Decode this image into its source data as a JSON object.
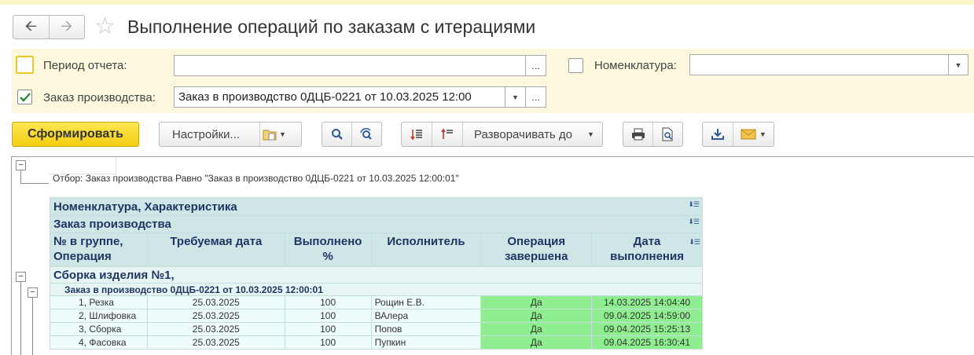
{
  "window": {
    "title": "Выполнение операций по заказам с итерациями"
  },
  "filters": {
    "period_label": "Период отчета:",
    "period_value": "",
    "period_checked": false,
    "nomenclature_label": "Номенклатура:",
    "nomenclature_value": "",
    "nomenclature_checked": false,
    "order_label": "Заказ производства:",
    "order_value": "Заказ в производство 0ДЦБ-0221 от 10.03.2025 12:00",
    "order_checked": true,
    "select_button": "..."
  },
  "toolbar": {
    "generate_label": "Сформировать",
    "settings_label": "Настройки...",
    "expand_label": "Разворачивать до"
  },
  "report": {
    "filter_text": "Отбор:   Заказ производства Равно \"Заказ в производство 0ДЦБ-0221 от 10.03.2025 12:00:01\"",
    "header_row1": "Номенклатура, Характеристика",
    "header_row2": "Заказ производства",
    "columns": [
      "№ в группе,\nОперация",
      "Требуемая дата",
      "Выполнено\n%",
      "Исполнитель",
      "Операция\nзавершена",
      "Дата\nвыполнения"
    ],
    "group_name": "Сборка изделия №1,",
    "subgroup_name": "Заказ в производство 0ДЦБ-0221 от 10.03.2025 12:00:01",
    "rows": [
      {
        "op": "1, Резка",
        "date": "25.03.2025",
        "pct": "100",
        "executor": "Рощин Е.В.",
        "done": "Да",
        "done_date": "14.03.2025 14:04:40"
      },
      {
        "op": "2, Шлифовка",
        "date": "25.03.2025",
        "pct": "100",
        "executor": "ВАлера",
        "done": "Да",
        "done_date": "09.04.2025 14:59:00"
      },
      {
        "op": "3, Сборка",
        "date": "25.03.2025",
        "pct": "100",
        "executor": "Попов",
        "done": "Да",
        "done_date": "09.04.2025 15:25:13"
      },
      {
        "op": "4, Фасовка",
        "date": "25.03.2025",
        "pct": "100",
        "executor": "Пупкин",
        "done": "Да",
        "done_date": "09.04.2025 16:30:41"
      }
    ]
  },
  "colors": {
    "accent_yellow": "#f2cd12",
    "header_bg": "#cfe6e6",
    "done_green": "#8fee8f",
    "header_text": "#1f3564"
  }
}
